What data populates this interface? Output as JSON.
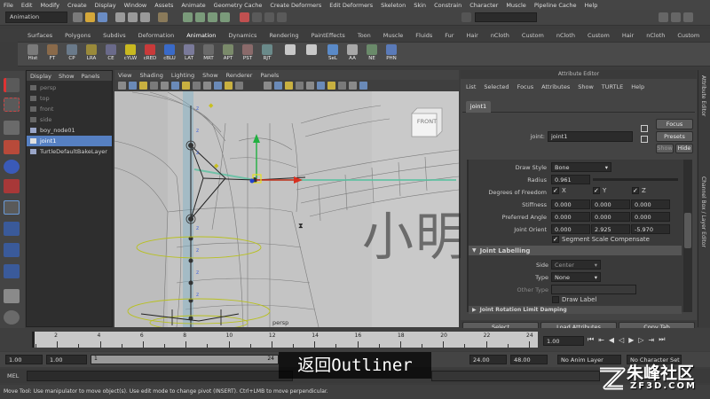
{
  "menubar": {
    "items": [
      "File",
      "Edit",
      "Modify",
      "Create",
      "Display",
      "Window",
      "Assets",
      "Animate",
      "Geometry Cache",
      "Create Deformers",
      "Edit Deformers",
      "Skeleton",
      "Skin",
      "Constrain",
      "Character",
      "Muscle",
      "Pipeline Cache",
      "Help"
    ]
  },
  "mode_select": "Animation",
  "shelf_tabs": [
    "Surfaces",
    "Polygons",
    "Subdivs",
    "Deformation",
    "Animation",
    "Dynamics",
    "Rendering",
    "PaintEffects",
    "Toon",
    "Muscle",
    "Fluids",
    "Fur",
    "Hair",
    "nCloth",
    "Custom",
    "nCloth",
    "Custom",
    "Hair",
    "nCloth",
    "Custom"
  ],
  "shelf_buttons": [
    "Hist",
    "FT",
    "CP",
    "LRA",
    "CE",
    "cYLW",
    "cRED",
    "cBLU",
    "LAT",
    "MRT",
    "APT",
    "PST",
    "RJT",
    "",
    "",
    "SeL",
    "AA",
    "NE",
    "PHN"
  ],
  "outliner": {
    "menu": [
      "Display",
      "Show",
      "Panels"
    ],
    "items": [
      {
        "label": "persp",
        "state": "dim"
      },
      {
        "label": "top",
        "state": "dim"
      },
      {
        "label": "front",
        "state": "dim"
      },
      {
        "label": "side",
        "state": "dim"
      },
      {
        "label": "boy_node01",
        "state": "normal"
      },
      {
        "label": "joint1",
        "state": "selected"
      },
      {
        "label": "TurtleDefaultBakeLayer",
        "state": "normal"
      }
    ]
  },
  "viewport": {
    "menu": [
      "View",
      "Shading",
      "Lighting",
      "Show",
      "Renderer",
      "Panels"
    ],
    "view_cube_label": "FRONT",
    "camera_label": "persp"
  },
  "attribute_editor": {
    "title": "Attribute Editor",
    "menu": [
      "List",
      "Selected",
      "Focus",
      "Attributes",
      "Show",
      "TURTLE",
      "Help"
    ],
    "tab": "joint1",
    "node_label": "joint:",
    "node_value": "joint1",
    "buttons": {
      "focus": "Focus",
      "presets": "Presets",
      "show": "Show",
      "hide": "Hide"
    },
    "draw_style": {
      "label": "Draw Style",
      "value": "Bone"
    },
    "radius": {
      "label": "Radius",
      "value": "0.961"
    },
    "degrees_of_freedom": {
      "label": "Degrees of Freedom",
      "x": "X",
      "y": "Y",
      "z": "Z"
    },
    "stiffness": {
      "label": "Stiffness",
      "values": [
        "0.000",
        "0.000",
        "0.000"
      ]
    },
    "preferred_angle": {
      "label": "Preferred Angle",
      "values": [
        "0.000",
        "0.000",
        "0.000"
      ]
    },
    "joint_orient": {
      "label": "Joint Orient",
      "values": [
        "0.000",
        "2.925",
        "-5.970"
      ]
    },
    "segment_scale": "Segment Scale Compensate",
    "joint_labelling": {
      "header": "Joint Labelling",
      "side_label": "Side",
      "side_value": "Center",
      "type_label": "Type",
      "type_value": "None",
      "other_type_label": "Other Type",
      "other_type_value": "",
      "draw_label": "Draw Label"
    },
    "next_section": "Joint Rotation Limit Damping",
    "footer": {
      "select": "Select",
      "load": "Load Attributes",
      "copy": "Copy Tab"
    }
  },
  "side_tabs": [
    "Attribute Editor",
    "Channel Box / Layer Editor"
  ],
  "timeline": {
    "ticks": [
      "2",
      "4",
      "6",
      "8",
      "10",
      "12",
      "14",
      "16",
      "18",
      "20",
      "22",
      "24"
    ],
    "current_frame": "1.00"
  },
  "range": {
    "start": "1.00",
    "inner_start": "1.00",
    "slider_start": "1",
    "slider_end": "24",
    "inner_end": "24.00",
    "end": "48.00",
    "anim_layer": "No Anim Layer",
    "char_set": "No Character Set"
  },
  "mel": {
    "label": "MEL"
  },
  "help_line": "Move Tool: Use manipulator to move object(s). Use edit mode to change pivot (INSERT). Ctrl+LMB to move perpendicular.",
  "subtitle": "返回Outliner",
  "watermark": "小明CG",
  "logo": {
    "text": "朱峰社区",
    "url": "ZF3D.COM"
  }
}
